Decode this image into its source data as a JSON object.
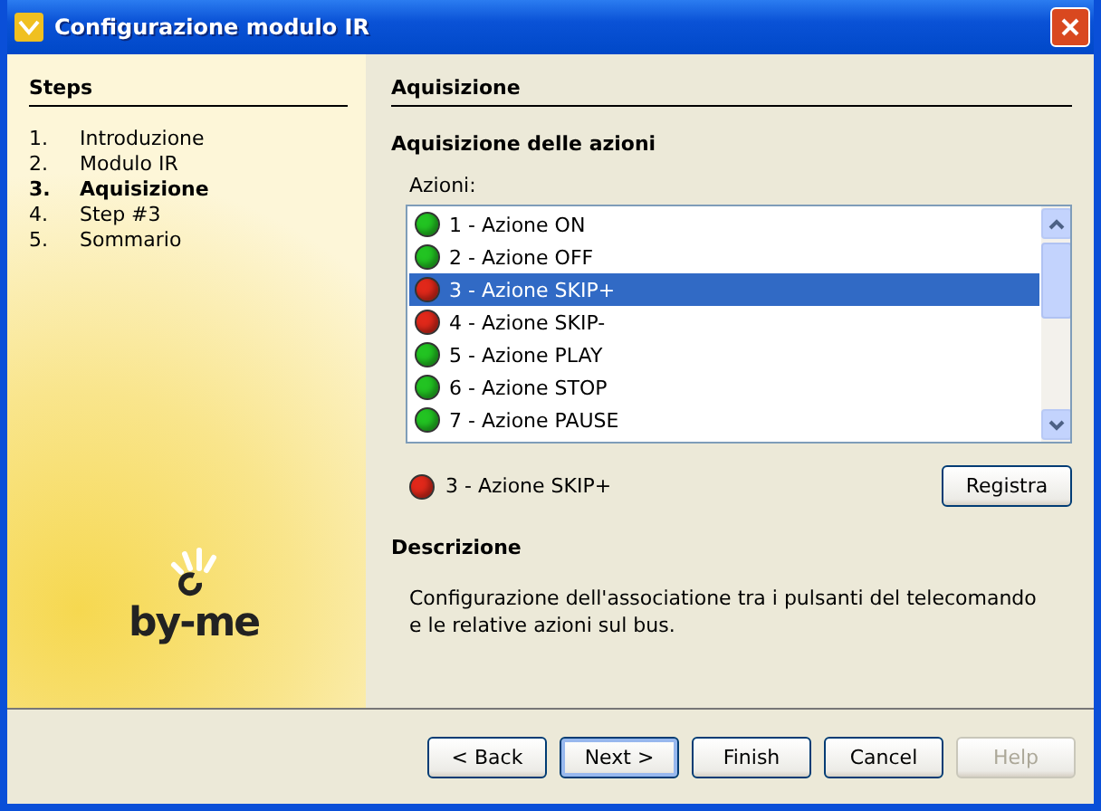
{
  "window": {
    "title": "Configurazione modulo IR"
  },
  "steps": {
    "title": "Steps",
    "items": [
      {
        "number": "1.",
        "label": "Introduzione",
        "selected": false
      },
      {
        "number": "2.",
        "label": "Modulo IR",
        "selected": false
      },
      {
        "number": "3.",
        "label": "Aquisizione",
        "selected": true
      },
      {
        "number": "4.",
        "label": "Step #3",
        "selected": false
      },
      {
        "number": "5.",
        "label": "Sommario",
        "selected": false
      }
    ]
  },
  "logo": "by-me",
  "page": {
    "title": "Aquisizione",
    "subtitle": "Aquisizione delle azioni",
    "list_label": "Azioni:",
    "actions": [
      {
        "label": "1 - Azione ON",
        "color": "#22c322",
        "selected": false
      },
      {
        "label": "2 - Azione OFF",
        "color": "#22c322",
        "selected": false
      },
      {
        "label": "3 - Azione SKIP+",
        "color": "#e0281a",
        "selected": true
      },
      {
        "label": "4 - Azione SKIP-",
        "color": "#e0281a",
        "selected": false
      },
      {
        "label": "5 - Azione PLAY",
        "color": "#22c322",
        "selected": false
      },
      {
        "label": "6 - Azione STOP",
        "color": "#22c322",
        "selected": false
      },
      {
        "label": "7 - Azione PAUSE",
        "color": "#22c322",
        "selected": false
      }
    ],
    "current": {
      "label": "3 - Azione SKIP+",
      "color": "#e0281a"
    },
    "record_button": "Registra",
    "description_title": "Descrizione",
    "description": "Configurazione dell'associatione tra i pulsanti del telecomando e le relative azioni sul bus."
  },
  "buttons": [
    {
      "label": "< Back",
      "disabled": false,
      "selected": false
    },
    {
      "label": "Next >",
      "selected": true,
      "disabled": false
    },
    {
      "label": "Finish",
      "disabled": false,
      "selected": false
    },
    {
      "label": "Cancel",
      "disabled": false,
      "selected": false
    },
    {
      "label": "Help",
      "disabled": true,
      "selected": false
    }
  ]
}
